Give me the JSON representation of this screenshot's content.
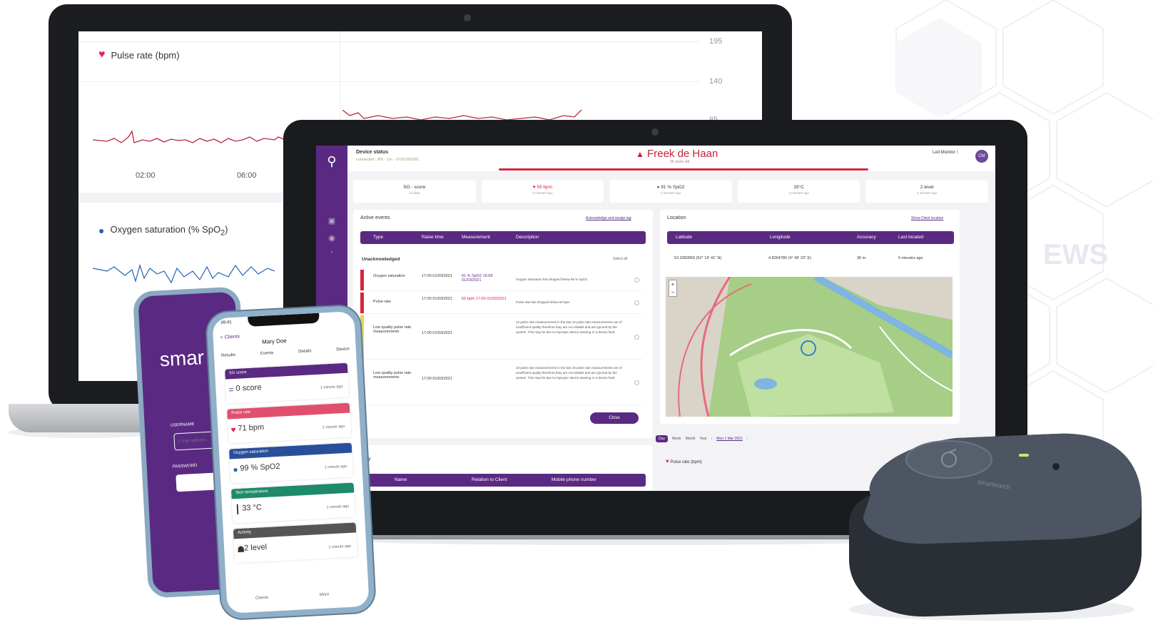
{
  "back_laptop": {
    "pulse_chart": {
      "title": "Pulse rate (bpm)",
      "y_ticks": [
        "195",
        "140",
        "85"
      ],
      "x_ticks": [
        "02:00",
        "06:00"
      ]
    },
    "oxygen_chart": {
      "title_main": "Oxygen saturation (% SpO",
      "title_sub": "2",
      "title_end": ")"
    }
  },
  "front_laptop": {
    "device_status": {
      "title": "Device status",
      "sub": "connected · 8% · 1m · 0730-001001"
    },
    "patient": {
      "name": "Freek de Haan",
      "age": "36 years old",
      "monitor": "Led Monitor !",
      "avatar_initials": "CM"
    },
    "stats": [
      {
        "label": "SO - score",
        "sub": "no data",
        "kind": "score"
      },
      {
        "label": "59 bpm",
        "sub": "4 minutes ago",
        "kind": "pulse"
      },
      {
        "label": "91 % SpO2",
        "sub": "4 minutes ago",
        "kind": "ox"
      },
      {
        "label": "33°C",
        "sub": "4 minutes ago",
        "kind": "temp"
      },
      {
        "label": "2 level",
        "sub": "4 minutes ago",
        "kind": "activity"
      }
    ],
    "events": {
      "title": "Active events",
      "link": "Acknowledge and assign tag",
      "headers": [
        "Type",
        "Raise time",
        "Measurement",
        "Description"
      ],
      "group": "Unacknowledged",
      "select_all": "Select all",
      "rows": [
        {
          "type": "Oxygen saturation",
          "time": "17:00 01/03/2021",
          "measurement": "91 % SpO2 16:58 01/03/2021",
          "description": "Oxygen saturation has dropped below 96 % SpO2",
          "color": "#d7263d"
        },
        {
          "type": "Pulse rate",
          "time": "17:00 01/03/2021",
          "measurement": "59 bpm 17:00 01/03/2021",
          "description": "Pulse rate has dropped below 60 bpm",
          "color": "#d7263d"
        },
        {
          "type": "Low quality pulse rate measurements",
          "time": "17:00 01/03/2021",
          "measurement": "",
          "description": "10 pulse rate measurements in the last 15 pulse rate measurements are of insufficient quality therefore they are not reliable and are ignored by the system. This may be due to improper device wearing or a device fault.",
          "color": "#e8d84a"
        },
        {
          "type": "Low quality pulse rate measurements",
          "time": "17:00 01/03/2021",
          "measurement": "",
          "description": "10 pulse rate measurements in the last 15 pulse rate measurements are of insufficient quality therefore they are not reliable and are ignored by the system. This may be due to improper device wearing or a device fault.",
          "color": "#e8d84a"
        }
      ],
      "close_label": "Close"
    },
    "location": {
      "title": "Location",
      "link": "Show Client location",
      "headers": [
        "Latitude",
        "Longitude",
        "Accuracy",
        "Last located"
      ],
      "latitude": "52.3282869 (52° 19' 41\" N)",
      "longitude": "4.8364786 (4° 49' 23\" E)",
      "accuracy": "30 m",
      "last_located": "6 minutes ago"
    },
    "range": {
      "tabs": [
        "Day",
        "Week",
        "Month",
        "Year"
      ],
      "active": "Day",
      "date": "Mon 1 Mar 2021"
    },
    "pulse_mini_title": "Pulse rate (bpm)",
    "family": {
      "title": "Family",
      "headers": [
        "Name",
        "Relation to Client",
        "Mobile phone number"
      ]
    }
  },
  "phone_login": {
    "brand": "smar",
    "username_label": "USERNAME",
    "username_placeholder": "E-mail address",
    "password_label": "PASSWORD"
  },
  "phone_app": {
    "time": "09:41",
    "back_label": "< Clients",
    "client_name": "Mary Doe",
    "tabs": [
      "Results",
      "Events",
      "Details",
      "Device"
    ],
    "tiles": [
      {
        "header": "5G score",
        "value": "0 score",
        "ago": "1 minute ago",
        "color": "#5a2a82",
        "icon": "="
      },
      {
        "header": "Pulse rate",
        "value": "71 bpm",
        "ago": "1 minute ago",
        "color": "#e0506e",
        "icon": "♥"
      },
      {
        "header": "Oxygen saturation",
        "value": "99 % SpO2",
        "ago": "1 minute ago",
        "color": "#2a4f9a",
        "icon": "💧"
      },
      {
        "header": "Skin temperature",
        "value": "33 °C",
        "ago": "1 minute ago",
        "color": "#1f8a6a",
        "icon": "🌡"
      },
      {
        "header": "Activity",
        "value": "2 level",
        "ago": "1 minute ago",
        "color": "#555555",
        "icon": "🏃"
      }
    ],
    "bottom_nav": [
      "Clients",
      "More"
    ]
  },
  "background": {
    "ews_mark": "EWS"
  }
}
